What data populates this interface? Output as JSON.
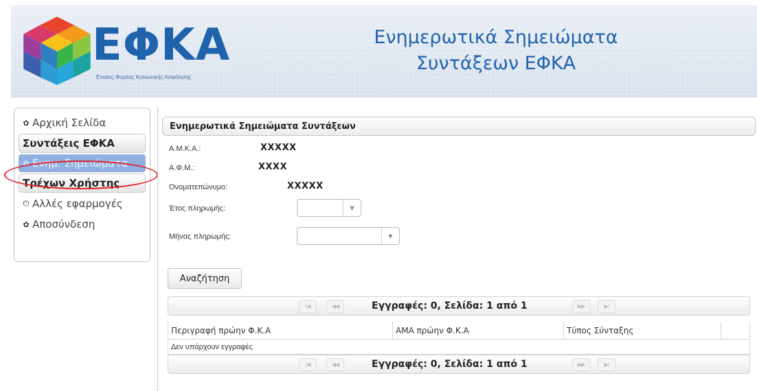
{
  "header": {
    "logo_text": "ΕΦΚΑ",
    "logo_subtitle": "Ενιαίος Φορέας Κοινωνικής Ασφάλισης",
    "title_line1": "Ενημερωτικά Σημειώματα",
    "title_line2": "Συντάξεων ΕΦΚΑ"
  },
  "sidebar": {
    "home": {
      "label": "Αρχική Σελίδα",
      "icon": "gear-icon"
    },
    "section_pensions": "Συντάξεις ΕΦΚΑ",
    "notes": {
      "label": "Ενημ. Σημειώματα",
      "icon": "gear-icon"
    },
    "section_user": "Τρέχων Χρήστης",
    "other_apps": {
      "label": "Αλλές εφαρμογές",
      "icon": "power-icon"
    },
    "logout": {
      "label": "Αποσύνδεση",
      "icon": "gear-icon"
    }
  },
  "panel": {
    "title": "Ενημερωτικά Σημειώματα Συντάξεων",
    "amka_label": "Α.Μ.Κ.Α.:",
    "amka_value": "XXXXX",
    "afm_label": "Α.Φ.Μ.:",
    "afm_value": "XXXX",
    "name_label": "Ονοματεπώνυμο:",
    "name_value": "XXXXX",
    "year_label": "Έτος πληρωμής:",
    "year_value": "",
    "month_label": "Μήνας πληρωμής:",
    "month_value": "",
    "search_button": "Αναζήτηση"
  },
  "grid": {
    "pager_text": "Εγγραφές: 0, Σελίδα: 1 από 1",
    "columns": [
      "Περιγραφή πρώην Φ.Κ.Α",
      "ΑΜΑ πρώην Φ.Κ.Α",
      "Τύπος Σύνταξης",
      ""
    ],
    "empty_message": "Δεν υπάρχουν εγγραφές"
  },
  "colors": {
    "brand_blue": "#1f63ad",
    "active_item": "#8fb0e0",
    "highlight_ring": "#e0202a"
  }
}
